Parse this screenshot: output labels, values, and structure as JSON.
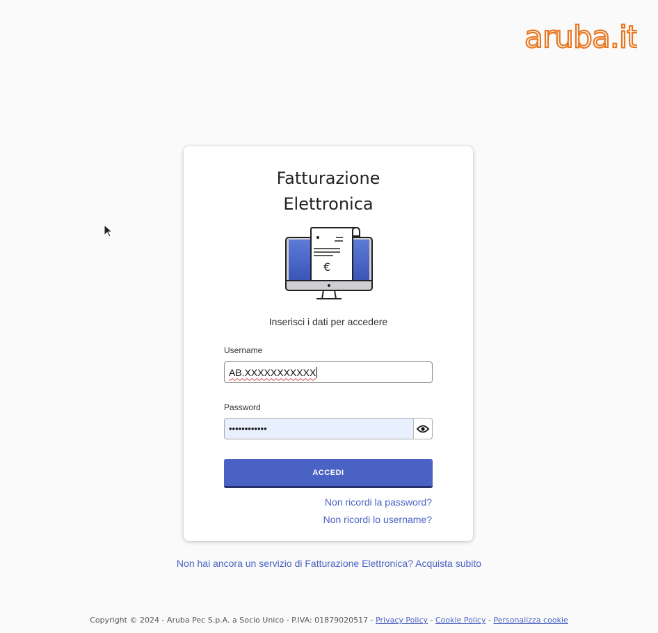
{
  "brand": {
    "logo_text": "aruba.it",
    "logo_color": "#e87722"
  },
  "card": {
    "title_line1": "Fatturazione",
    "title_line2": "Elettronica",
    "illustration_icon": "monitor-invoice-euro-icon",
    "subtitle": "Inserisci i dati per accedere",
    "username": {
      "label": "Username",
      "value": "AB.XXXXXXXXXXX"
    },
    "password": {
      "label": "Password",
      "masked_value": "••••••••••••",
      "toggle_icon": "eye-icon"
    },
    "submit_label": "ACCEDI",
    "forgot_password": "Non ricordi la password?",
    "forgot_username": "Non ricordi lo username?"
  },
  "promo": {
    "text": "Non hai ancora un servizio di Fatturazione Elettronica? Acquista subito"
  },
  "footer": {
    "copyright": "Copyright © 2024 - Aruba Pec S.p.A. a Socio Unico - P.IVA: 01879020517 -",
    "privacy": "Privacy Policy",
    "cookie": "Cookie Policy",
    "customize": "Personalizza cookie",
    "separator": " - "
  },
  "colors": {
    "accent": "#4a62c3",
    "button_border": "#26306a",
    "background": "#fafafa"
  }
}
